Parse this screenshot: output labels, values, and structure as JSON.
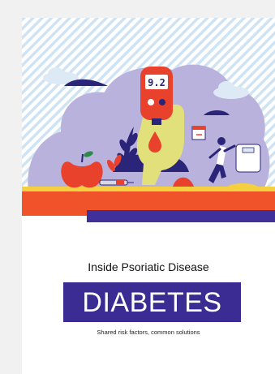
{
  "cover": {
    "meter_reading": "9.2",
    "kicker": "Inside Psoriatic Disease",
    "title": "DIABETES",
    "subtitle": "Shared risk factors, common solutions"
  },
  "colors": {
    "orange": "#f0522a",
    "purple": "#3a2c93",
    "lavender": "#b9b2dc",
    "sky_stripes": "#cfe3f3"
  },
  "icons": [
    "glucose-meter-icon",
    "apple-icon",
    "runner-icon",
    "scale-icon",
    "calendar-icon",
    "blood-drop-icon",
    "leaf-icon",
    "cloud-icon"
  ]
}
